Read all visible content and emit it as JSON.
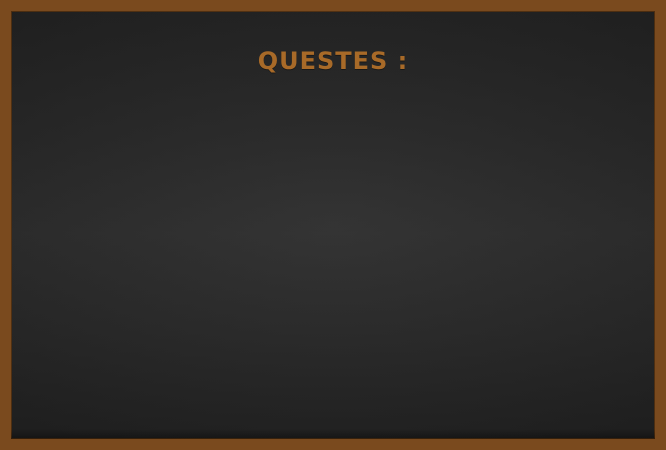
{
  "board": {
    "title": "QUESTES :",
    "quests": []
  },
  "colors": {
    "frame": "#7a4a1e",
    "board": "#2b2b2b",
    "title": "#a86a28"
  }
}
